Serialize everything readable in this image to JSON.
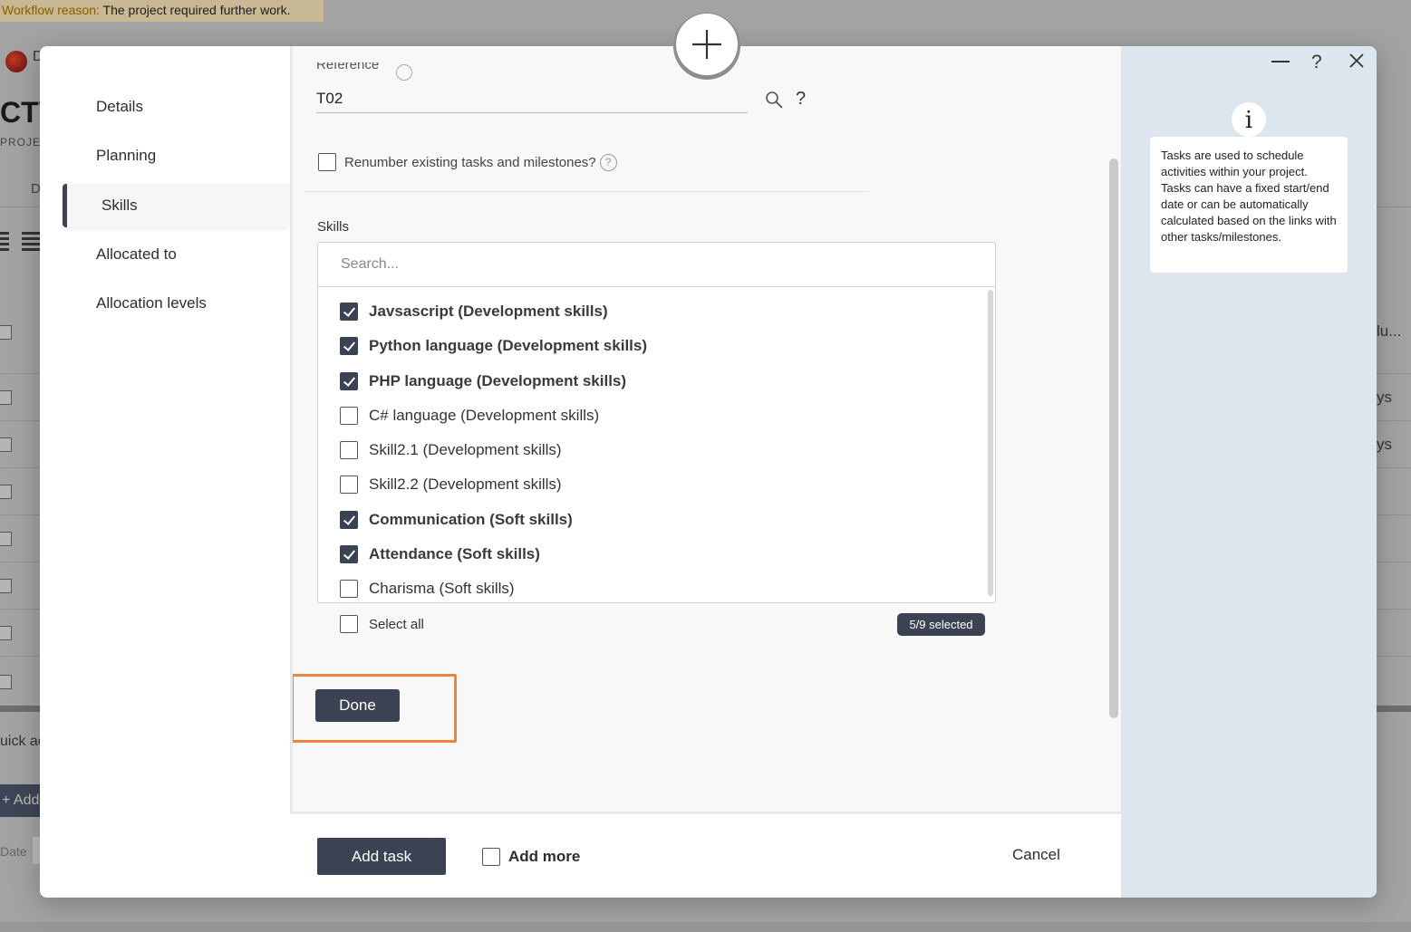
{
  "background": {
    "workflow_label": "Workflow reason:",
    "workflow_text": "The project required further work.",
    "logo_letter": "D",
    "title": "CTV",
    "subtitle": "PROJEC",
    "tab_letter": "D",
    "right_col_header": "lu...",
    "right_col_row1": "ys",
    "right_col_row2": "ys",
    "quick_action": "uick ac",
    "add_button": "+ Add",
    "date_label": "Date"
  },
  "nav": {
    "items": [
      "Details",
      "Planning",
      "Skills",
      "Allocated to",
      "Allocation levels"
    ],
    "active": "Skills"
  },
  "reference": {
    "label": "Reference",
    "value": "T02",
    "help": "?"
  },
  "renumber": {
    "label": "Renumber existing tasks and milestones?",
    "checked": false,
    "help": "?"
  },
  "skills": {
    "label": "Skills",
    "search_placeholder": "Search...",
    "items": [
      {
        "label": "Javsascript (Development skills)",
        "checked": true
      },
      {
        "label": "Python language (Development skills)",
        "checked": true
      },
      {
        "label": "PHP language (Development skills)",
        "checked": true
      },
      {
        "label": "C# language (Development skills)",
        "checked": false
      },
      {
        "label": "Skill2.1 (Development skills)",
        "checked": false
      },
      {
        "label": "Skill2.2 (Development skills)",
        "checked": false
      },
      {
        "label": "Communication (Soft skills)",
        "checked": true
      },
      {
        "label": "Attendance (Soft skills)",
        "checked": true
      },
      {
        "label": "Charisma (Soft skills)",
        "checked": false
      }
    ],
    "select_all_label": "Select all",
    "count_badge": "5/9 selected"
  },
  "done_label": "Done",
  "footer": {
    "add_task_label": "Add task",
    "add_more_label": "Add more",
    "cancel_label": "Cancel"
  },
  "info": {
    "icon_letter": "i",
    "text": "Tasks are used to schedule activities within your project. Tasks can have a fixed start/end date or can be automatically calculated based on the links with other tasks/milestones.",
    "help": "?"
  },
  "colors": {
    "primary": "#3b4254",
    "highlight": "#f0843a",
    "info_panel": "#dde5ef"
  },
  "icons": [
    "plus-icon",
    "search-icon",
    "minimize-icon",
    "close-icon",
    "info-icon",
    "checkmark-icon"
  ]
}
